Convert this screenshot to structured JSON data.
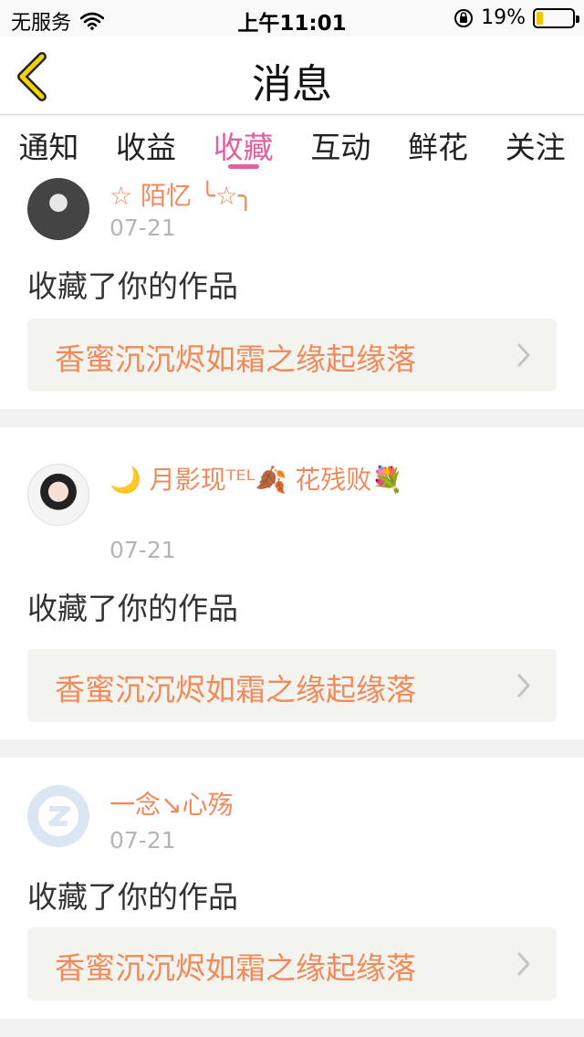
{
  "status_bar": {
    "carrier": "无服务",
    "time": "上午11:01",
    "battery_percent": "19%",
    "battery_level": 0.19,
    "battery_color": "#f5c400"
  },
  "nav": {
    "title": "消息",
    "back_icon": "chevron-left-icon",
    "back_icon_color": "#f5d200"
  },
  "tabs": [
    {
      "label": "通知",
      "active": false
    },
    {
      "label": "收益",
      "active": false
    },
    {
      "label": "收藏",
      "active": true
    },
    {
      "label": "互动",
      "active": false
    },
    {
      "label": "鲜花",
      "active": false
    },
    {
      "label": "关注",
      "active": false
    }
  ],
  "colors": {
    "accent_pink": "#e0619d",
    "name_orange": "#f08a5d",
    "date_gray": "#b5b5b5"
  },
  "messages": [
    {
      "user": "☆ 陌忆 ╰☆╮",
      "date": "07-21",
      "action": "收藏了你的作品",
      "work_title": "香蜜沉沉烬如霜之缘起缘落"
    },
    {
      "user": "🌙 月影现ᵀᴱᴸ🍂 花残败💐",
      "date": "07-21",
      "action": "收藏了你的作品",
      "work_title": "香蜜沉沉烬如霜之缘起缘落"
    },
    {
      "user": "一念↘心殇",
      "date": "07-21",
      "action": "收藏了你的作品",
      "work_title": "香蜜沉沉烬如霜之缘起缘落"
    }
  ]
}
